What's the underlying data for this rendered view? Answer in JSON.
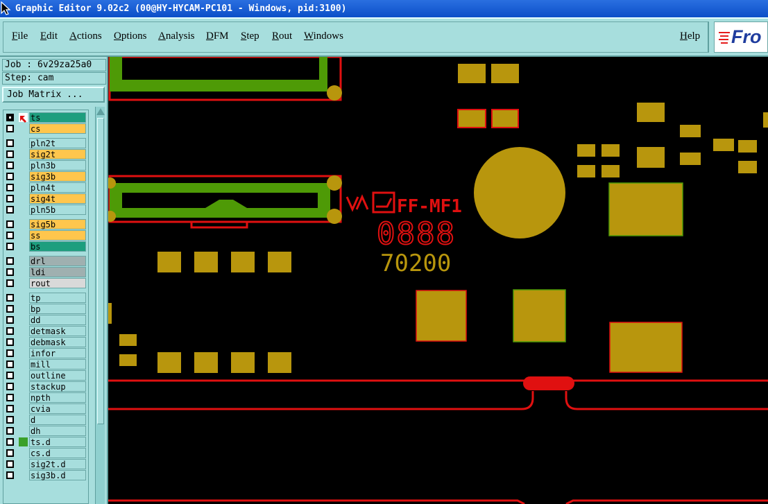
{
  "window": {
    "title": "Graphic Editor 9.02c2 (00@HY-HYCAM-PC101 - Windows, pid:3100)"
  },
  "menu": {
    "items": [
      "File",
      "Edit",
      "Actions",
      "Options",
      "Analysis",
      "DFM",
      "Step",
      "Rout",
      "Windows"
    ],
    "help": "Help"
  },
  "logo": {
    "text": "Fro"
  },
  "job": {
    "job_label": "Job : 6v29za25a0",
    "step_label": "Step: cam",
    "matrix_button": "Job Matrix ..."
  },
  "layers": [
    {
      "name": "ts",
      "color": "#1e9e7e",
      "active": true
    },
    {
      "name": "cs",
      "color": "#ffc64d"
    },
    {
      "name": "pln2t",
      "color": "#a7dedd"
    },
    {
      "name": "sig2t",
      "color": "#ffc64d"
    },
    {
      "name": "pln3b",
      "color": "#a7dedd"
    },
    {
      "name": "sig3b",
      "color": "#ffc64d"
    },
    {
      "name": "pln4t",
      "color": "#a7dedd"
    },
    {
      "name": "sig4t",
      "color": "#ffc64d"
    },
    {
      "name": "pln5b",
      "color": "#a7dedd"
    },
    {
      "name": "sig5b",
      "color": "#ffc64d"
    },
    {
      "name": "ss",
      "color": "#ffc64d"
    },
    {
      "name": "bs",
      "color": "#1e9e7e"
    },
    {
      "name": "drl",
      "color": "#9fb0b0"
    },
    {
      "name": "ldi",
      "color": "#9fb0b0"
    },
    {
      "name": "rout",
      "color": "#d9d9d9"
    },
    {
      "name": "tp",
      "color": "#a7dedd"
    },
    {
      "name": "bp",
      "color": "#a7dedd"
    },
    {
      "name": "dd",
      "color": "#a7dedd"
    },
    {
      "name": "detmask",
      "color": "#a7dedd"
    },
    {
      "name": "debmask",
      "color": "#a7dedd"
    },
    {
      "name": "infor",
      "color": "#a7dedd"
    },
    {
      "name": "mill",
      "color": "#a7dedd"
    },
    {
      "name": "outline",
      "color": "#a7dedd"
    },
    {
      "name": "stackup",
      "color": "#a7dedd"
    },
    {
      "name": "npth",
      "color": "#a7dedd"
    },
    {
      "name": "cvia",
      "color": "#a7dedd"
    },
    {
      "name": "d",
      "color": "#a7dedd"
    },
    {
      "name": "dh",
      "color": "#a7dedd"
    },
    {
      "name": "ts.d",
      "color": "#a7dedd",
      "flag": "green"
    },
    {
      "name": "cs.d",
      "color": "#a7dedd"
    },
    {
      "name": "sig2t.d",
      "color": "#a7dedd"
    },
    {
      "name": "sig3b.d",
      "color": "#a7dedd"
    }
  ],
  "board": {
    "silk_text_1": "FF-MF1",
    "silk_text_2": "0888",
    "copper_text": "70200",
    "colors": {
      "copper": "#b8960d",
      "solder_mask": "#e01010",
      "silk_green": "#4e9a06",
      "background": "#000000"
    }
  },
  "colors": {
    "panel": "#a7dedd",
    "titlebar": "#0b4fc8"
  }
}
